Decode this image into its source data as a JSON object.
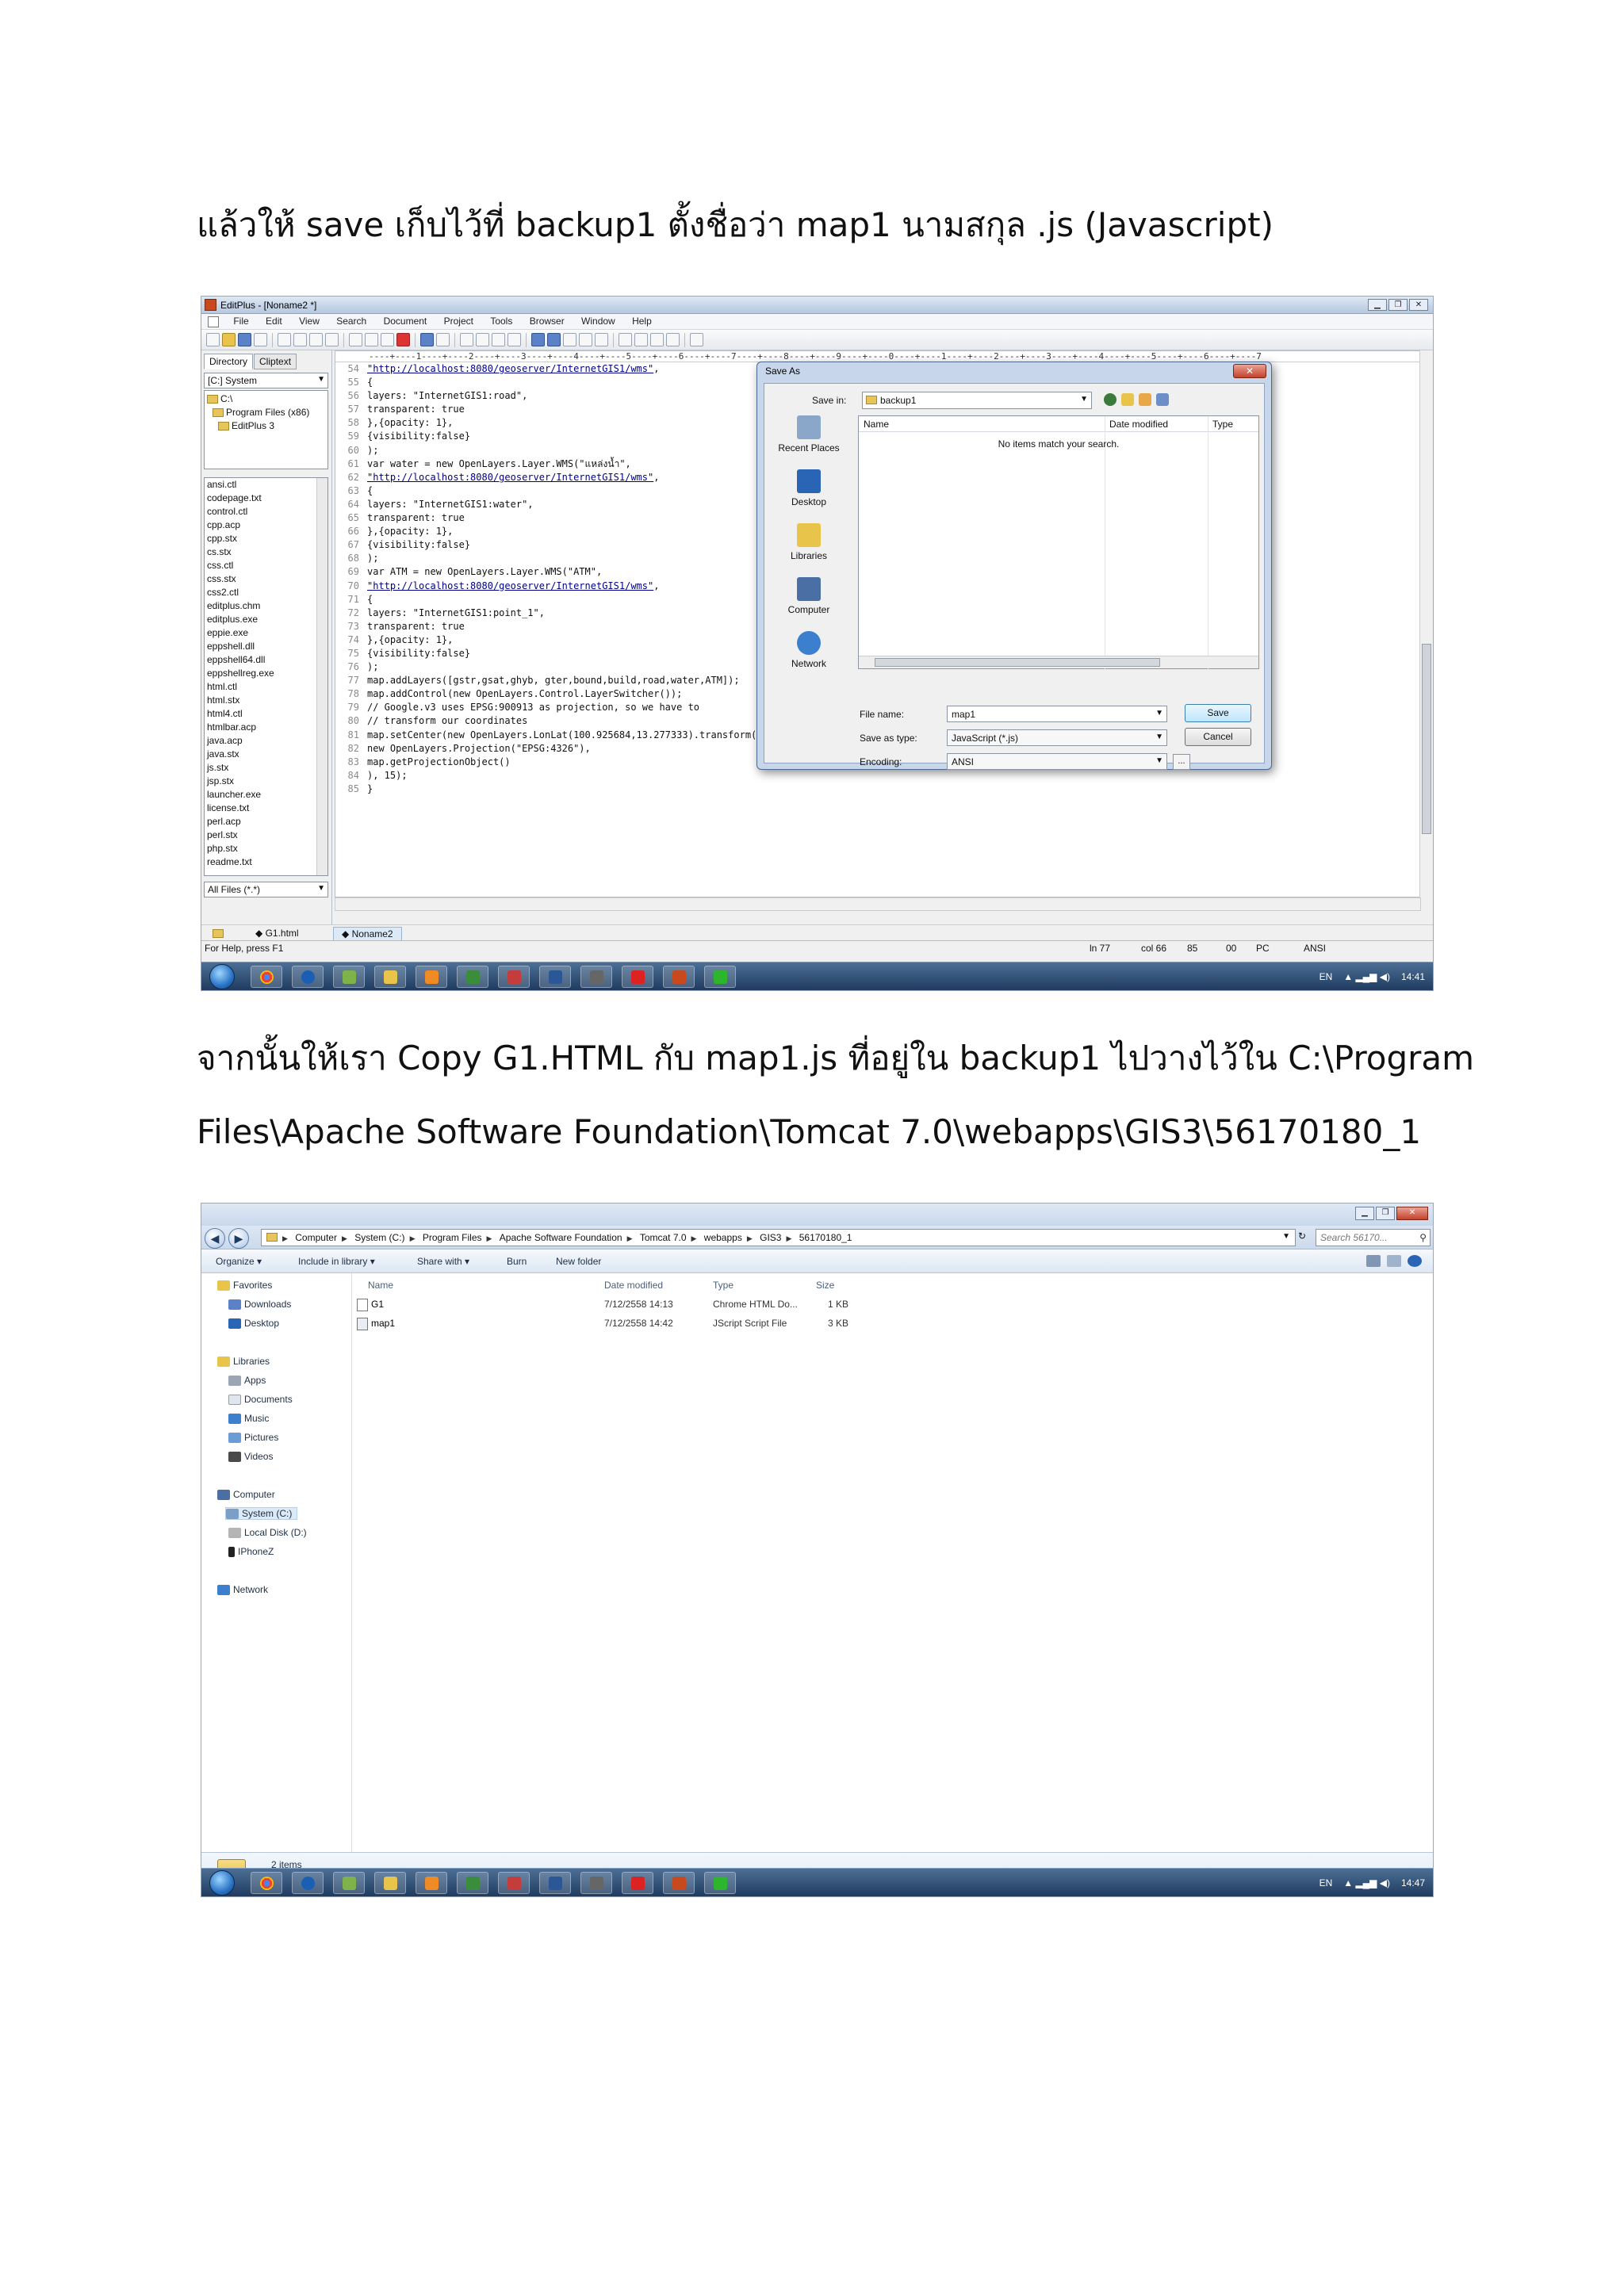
{
  "instructions": {
    "step1": "แล้วให้ save เก็บไว้ที่ backup1 ตั้งชื่อว่า map1 นามสกุล .js (Javascript)",
    "step2_line1": "จากนั้นให้เรา Copy G1.HTML กับ map1.js ที่อยู่ใน backup1 ไปวางไว้ใน C:\\Program",
    "step2_line2": "Files\\Apache Software Foundation\\Tomcat 7.0\\webapps\\GIS3\\56170180_1"
  },
  "editplus": {
    "window_title": "EditPlus - [Noname2 *]",
    "menu": [
      "File",
      "Edit",
      "View",
      "Search",
      "Document",
      "Project",
      "Tools",
      "Browser",
      "Window",
      "Help"
    ],
    "tabs": [
      "Directory",
      "Cliptext"
    ],
    "drive": "[C:] System",
    "tree": [
      "C:\\",
      "Program Files (x86)",
      "EditPlus 3"
    ],
    "files": [
      "ansi.ctl",
      "codepage.txt",
      "control.ctl",
      "cpp.acp",
      "cpp.stx",
      "cs.stx",
      "css.ctl",
      "css.stx",
      "css2.ctl",
      "editplus.chm",
      "editplus.exe",
      "eppie.exe",
      "eppshell.dll",
      "eppshell64.dll",
      "eppshellreg.exe",
      "html.ctl",
      "html.stx",
      "html4.ctl",
      "htmlbar.acp",
      "java.acp",
      "java.stx",
      "js.stx",
      "jsp.stx",
      "launcher.exe",
      "license.txt",
      "perl.acp",
      "perl.stx",
      "php.stx",
      "readme.txt"
    ],
    "filter": "All Files (*.*)",
    "ruler": "----+----1----+----2----+----3----+----4----+----5----+----6----+----7----+----8----+----9----+----0----+----1----+----2----+----3----+----4----+----5----+----6----+----7",
    "code_lines": [
      {
        "n": "54",
        "t": "",
        "u": "\"http://localhost:8080/geoserver/InternetGIS1/wms\"",
        "s": ","
      },
      {
        "n": "55",
        "t": "{",
        "u": "",
        "s": ""
      },
      {
        "n": "56",
        "t": "layers: \"InternetGIS1:road\",",
        "u": "",
        "s": ""
      },
      {
        "n": "57",
        "t": "transparent: true",
        "u": "",
        "s": ""
      },
      {
        "n": "58",
        "t": "},{opacity: 1},",
        "u": "",
        "s": ""
      },
      {
        "n": "59",
        "t": "{visibility:false}",
        "u": "",
        "s": ""
      },
      {
        "n": "60",
        "t": ");",
        "u": "",
        "s": ""
      },
      {
        "n": "61",
        "t": "var water = new OpenLayers.Layer.WMS(\"แหล่งน้ำ\",",
        "u": "",
        "s": ""
      },
      {
        "n": "62",
        "t": "",
        "u": "\"http://localhost:8080/geoserver/InternetGIS1/wms\"",
        "s": ","
      },
      {
        "n": "63",
        "t": "{",
        "u": "",
        "s": ""
      },
      {
        "n": "64",
        "t": "layers: \"InternetGIS1:water\",",
        "u": "",
        "s": ""
      },
      {
        "n": "65",
        "t": "transparent: true",
        "u": "",
        "s": ""
      },
      {
        "n": "66",
        "t": "},{opacity: 1},",
        "u": "",
        "s": ""
      },
      {
        "n": "67",
        "t": "{visibility:false}",
        "u": "",
        "s": ""
      },
      {
        "n": "68",
        "t": ");",
        "u": "",
        "s": ""
      },
      {
        "n": "69",
        "t": "var ATM = new OpenLayers.Layer.WMS(\"ATM\",",
        "u": "",
        "s": ""
      },
      {
        "n": "70",
        "t": "",
        "u": "\"http://localhost:8080/geoserver/InternetGIS1/wms\"",
        "s": ","
      },
      {
        "n": "71",
        "t": "{",
        "u": "",
        "s": ""
      },
      {
        "n": "72",
        "t": "layers: \"InternetGIS1:point_1\",",
        "u": "",
        "s": ""
      },
      {
        "n": "73",
        "t": "transparent: true",
        "u": "",
        "s": ""
      },
      {
        "n": "74",
        "t": "},{opacity: 1},",
        "u": "",
        "s": ""
      },
      {
        "n": "75",
        "t": "{visibility:false}",
        "u": "",
        "s": ""
      },
      {
        "n": "76",
        "t": ");",
        "u": "",
        "s": ""
      },
      {
        "n": "77",
        "t": "map.addLayers([gstr,gsat,ghyb, gter,bound,build,road,water,ATM]);",
        "u": "",
        "s": ""
      },
      {
        "n": "78",
        "t": "map.addControl(new OpenLayers.Control.LayerSwitcher());",
        "u": "",
        "s": ""
      },
      {
        "n": "79",
        "t": "// Google.v3 uses EPSG:900913 as projection, so we have to",
        "u": "",
        "s": ""
      },
      {
        "n": "80",
        "t": "// transform our coordinates",
        "u": "",
        "s": ""
      },
      {
        "n": "81",
        "t": "map.setCenter(new OpenLayers.LonLat(100.925684,13.277333).transform(",
        "u": "",
        "s": ""
      },
      {
        "n": "82",
        "t": "new OpenLayers.Projection(\"EPSG:4326\"),",
        "u": "",
        "s": ""
      },
      {
        "n": "83",
        "t": "map.getProjectionObject()",
        "u": "",
        "s": ""
      },
      {
        "n": "84",
        "t": "), 15);",
        "u": "",
        "s": ""
      },
      {
        "n": "85",
        "t": "}",
        "u": "",
        "s": ""
      }
    ],
    "doc_tabs": [
      "G1.html",
      "Noname2"
    ],
    "status_help": "For Help, press F1",
    "status": {
      "ln": "ln 77",
      "col": "col 66",
      "num": "85",
      "ov": "00",
      "pc": "PC",
      "enc": "ANSI"
    },
    "clock": "14:41",
    "lang": "EN"
  },
  "save_dialog": {
    "title": "Save As",
    "close": "✕",
    "save_in_label": "Save in:",
    "save_in_value": "backup1",
    "places": [
      "Recent Places",
      "Desktop",
      "Libraries",
      "Computer",
      "Network"
    ],
    "columns": [
      "Name",
      "Date modified",
      "Type"
    ],
    "empty_message": "No items match your search.",
    "file_name_label": "File name:",
    "file_name_value": "map1",
    "save_as_type_label": "Save as type:",
    "save_as_type_value": "JavaScript (*.js)",
    "encoding_label": "Encoding:",
    "encoding_value": "ANSI",
    "save_button": "Save",
    "cancel_button": "Cancel",
    "ellipsis": "..."
  },
  "explorer": {
    "breadcrumb": [
      "Computer",
      "System (C:)",
      "Program Files",
      "Apache Software Foundation",
      "Tomcat 7.0",
      "webapps",
      "GIS3",
      "56170180_1"
    ],
    "search_placeholder": "Search 56170...",
    "commands": [
      "Organize ▾",
      "Include in library ▾",
      "Share with ▾",
      "Burn",
      "New folder"
    ],
    "nav": {
      "favorites": "Favorites",
      "downloads": "Downloads",
      "desktop": "Desktop",
      "libraries": "Libraries",
      "apps": "Apps",
      "documents": "Documents",
      "music": "Music",
      "pictures": "Pictures",
      "videos": "Videos",
      "computer": "Computer",
      "system": "System (C:)",
      "localdisk": "Local Disk (D:)",
      "iphone": "IPhoneZ",
      "network": "Network"
    },
    "columns": [
      "Name",
      "Date modified",
      "Type",
      "Size"
    ],
    "files": [
      {
        "name": "G1",
        "date": "7/12/2558 14:13",
        "type": "Chrome HTML Do...",
        "size": "1 KB"
      },
      {
        "name": "map1",
        "date": "7/12/2558 14:42",
        "type": "JScript Script File",
        "size": "3 KB"
      }
    ],
    "item_count": "2 items",
    "clock": "14:47",
    "lang": "EN"
  },
  "colors": {
    "accent": "#3c7fb1",
    "taskbar": "#1f3b5f",
    "url": "#00008b"
  }
}
